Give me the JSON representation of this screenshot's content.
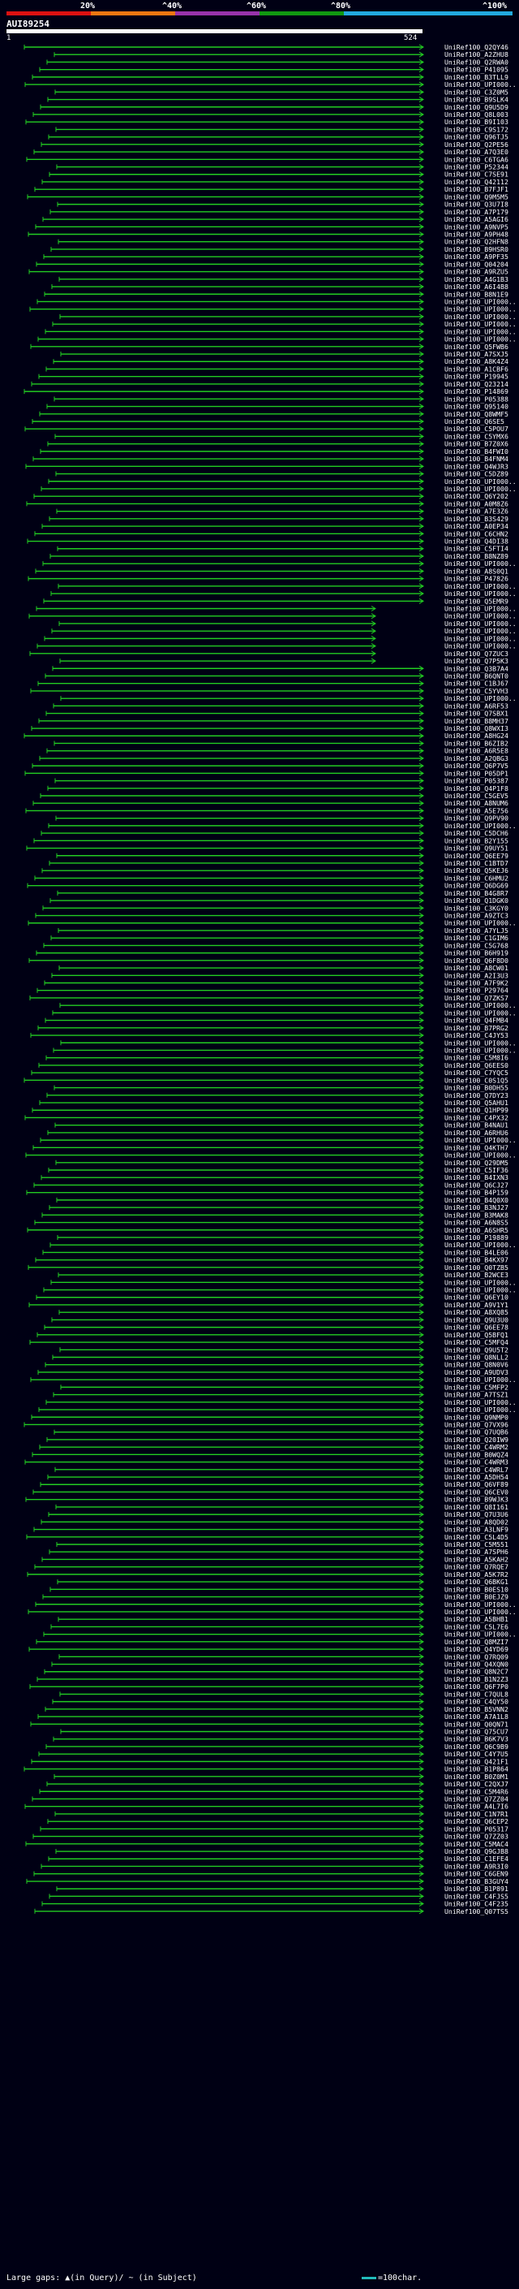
{
  "scale": {
    "colors": [
      "#dd1111",
      "#ee7711",
      "#9933aa",
      "#119911",
      "#22aadd"
    ],
    "labels": [
      "20%",
      "^40%",
      "^60%",
      "^80%",
      "^100%"
    ]
  },
  "query": {
    "title": "AUI89254",
    "start_label": "1",
    "end_label": "524"
  },
  "alignments": {
    "line_color": "#22cc22",
    "label_color": "#ffffff",
    "labels": [
      "UniRef100_Q2QY46",
      "UniRef100_A2ZHU8",
      "UniRef100_Q2RWA0",
      "UniRef100_P41095",
      "UniRef100_B3TLL9",
      "UniRef100_UPI000..",
      "UniRef100_C3Z0M5",
      "UniRef100_B9SLK4",
      "UniRef100_Q9U5D9",
      "UniRef100_Q8L003",
      "UniRef100_B9I103",
      "UniRef100_C9S172",
      "UniRef100_Q96TJ5",
      "UniRef100_Q2PE56",
      "UniRef100_A7Q3E0",
      "UniRef100_C6TGA6",
      "UniRef100_P52344",
      "UniRef100_C7SE91",
      "UniRef100_Q42112",
      "UniRef100_B7FJF1",
      "UniRef100_Q9M5M5",
      "UniRef100_Q3U7I8",
      "UniRef100_A7P179",
      "UniRef100_A5AGI6",
      "UniRef100_A9NVP5",
      "UniRef100_A9PH48",
      "UniRef100_Q2HFN8",
      "UniRef100_B9HSR0",
      "UniRef100_A9PF35",
      "UniRef100_Q04204",
      "UniRef100_A9RZU5",
      "UniRef100_A4G1B3",
      "UniRef100_A6I4B8",
      "UniRef100_B8N1E9",
      "UniRef100_UPI000..",
      "UniRef100_UPI000..",
      "UniRef100_UPI000..",
      "UniRef100_UPI000..",
      "UniRef100_UPI000..",
      "UniRef100_UPI000..",
      "UniRef100_Q5FWB6",
      "UniRef100_A7SXJ5",
      "UniRef100_A8K4Z4",
      "UniRef100_A1CBF6",
      "UniRef100_P19945",
      "UniRef100_Q23214",
      "UniRef100_P14869",
      "UniRef100_P05388",
      "UniRef100_Q95140",
      "UniRef100_Q8WMF5",
      "UniRef100_Q6SE5",
      "UniRef100_C5POU7",
      "UniRef100_C5YMX6",
      "UniRef100_B7Z0X6",
      "UniRef100_B4FWI0",
      "UniRef100_B4FNM4",
      "UniRef100_Q4WJR3",
      "UniRef100_C5DZ89",
      "UniRef100_UPI000..",
      "UniRef100_UPI000..",
      "UniRef100_Q6Y202",
      "UniRef100_A0M8Z6",
      "UniRef100_A7E3Z6",
      "UniRef100_B3S429",
      "UniRef100_A0EP34",
      "UniRef100_C6CHN2",
      "UniRef100_Q4DI38",
      "UniRef100_C5FTI4",
      "UniRef100_B8NZ89",
      "UniRef100_UPI000..",
      "UniRef100_A8S0Q1",
      "UniRef100_P47826",
      "UniRef100_UPI000..",
      "UniRef100_UPI000..",
      "UniRef100_Q5EMR9",
      "UniRef100_UPI000..",
      "UniRef100_UPI000..",
      "UniRef100_UPI000..",
      "UniRef100_UPI000..",
      "UniRef100_UPI000..",
      "UniRef100_UPI000..",
      "UniRef100_Q7ZUC3",
      "UniRef100_Q7P5K3",
      "UniRef100_Q3B7A4",
      "UniRef100_B6QNT0",
      "UniRef100_C1BJ67",
      "UniRef100_C5YVH3",
      "UniRef100_UPI000..",
      "UniRef100_A6RF53",
      "UniRef100_Q7SBX1",
      "UniRef100_B8MH37",
      "UniRef100_Q8WXI3",
      "UniRef100_A8HG24",
      "UniRef100_B6ZIB2",
      "UniRef100_A6R5E8",
      "UniRef100_A2QBG3",
      "UniRef100_Q6P7V5",
      "UniRef100_P05DP1",
      "UniRef100_P05387",
      "UniRef100_Q4P1F8",
      "UniRef100_C5GEV5",
      "UniRef100_A8NUM6",
      "UniRef100_A5E756",
      "UniRef100_Q9PV90",
      "UniRef100_UPI000..",
      "UniRef100_C5DCH6",
      "UniRef100_B2Y155",
      "UniRef100_Q9UY51",
      "UniRef100_Q6EE79",
      "UniRef100_C1BTD7",
      "UniRef100_Q5KEJ6",
      "UniRef100_C6HMU2",
      "UniRef100_Q6DG69",
      "UniRef100_B4G8R7",
      "UniRef100_Q1DGK0",
      "UniRef100_C3KGY0",
      "UniRef100_A9ZTC3",
      "UniRef100_UPI000..",
      "UniRef100_A7YLJ5",
      "UniRef100_C1GIM6",
      "UniRef100_C5G768",
      "UniRef100_B6H919",
      "UniRef100_Q6F8D0",
      "UniRef100_A8CW01",
      "UniRef100_A2I3U3",
      "UniRef100_A7F9K2",
      "UniRef100_P29764",
      "UniRef100_Q7ZKS7",
      "UniRef100_UPI000..",
      "UniRef100_UPI000..",
      "UniRef100_Q4FMB4",
      "UniRef100_B7PRG2",
      "UniRef100_C4JY53",
      "UniRef100_UPI000..",
      "UniRef100_UPI000..",
      "UniRef100_C5M8I6",
      "UniRef100_Q6EES0",
      "UniRef100_C7YQC5",
      "UniRef100_C0S1Q5",
      "UniRef100_B0DH55",
      "UniRef100_Q7DY23",
      "UniRef100_Q5AHU1",
      "UniRef100_Q1HP99",
      "UniRef100_C4PX32",
      "UniRef100_B4NAU1",
      "UniRef100_A6RHU6",
      "UniRef100_UPI000..",
      "UniRef100_Q4KTH7",
      "UniRef100_UPI000..",
      "UniRef100_Q29DM5",
      "UniRef100_C5IF36",
      "UniRef100_B4IXN3",
      "UniRef100_Q6CJ27",
      "UniRef100_B4P159",
      "UniRef100_B4Q0X0",
      "UniRef100_B3NJ27",
      "UniRef100_B3MAK8",
      "UniRef100_A6N8S5",
      "UniRef100_A6SHR5",
      "UniRef100_P19889",
      "UniRef100_UPI000..",
      "UniRef100_B4LE06",
      "UniRef100_B4KX97",
      "UniRef100_Q0TZB5",
      "UniRef100_B2WCE3",
      "UniRef100_UPI000..",
      "UniRef100_UPI000..",
      "UniRef100_Q6EY10",
      "UniRef100_A9V1Y1",
      "UniRef100_A8XQ85",
      "UniRef100_Q9U3U0",
      "UniRef100_Q6EE78",
      "UniRef100_Q5BFQ1",
      "UniRef100_C5MFQ4",
      "UniRef100_Q9U5T2",
      "UniRef100_Q8NLL2",
      "UniRef100_Q8N0V6",
      "UniRef100_A9UDV3",
      "UniRef100_UPI000..",
      "UniRef100_C5MFP2",
      "UniRef100_A7TSZ1",
      "UniRef100_UPI000..",
      "UniRef100_UPI000..",
      "UniRef100_Q9NMP0",
      "UniRef100_Q7VX96",
      "UniRef100_Q7UQB6",
      "UniRef100_Q20IW9",
      "UniRef100_C4WRM2",
      "UniRef100_B0WQZ4",
      "UniRef100_C4WRM3",
      "UniRef100_C4WRL7",
      "UniRef100_A5DH54",
      "UniRef100_Q6VF89",
      "UniRef100_Q6CEV0",
      "UniRef100_B9WJK3",
      "UniRef100_Q8I161",
      "UniRef100_Q7U3U6",
      "UniRef100_A8QD02",
      "UniRef100_A3LNF9",
      "UniRef100_C5L4D5",
      "UniRef100_C5M551",
      "UniRef100_A7SPH6",
      "UniRef100_A5KAH2",
      "UniRef100_Q7RQE7",
      "UniRef100_A5K7R2",
      "UniRef100_Q6BKG1",
      "UniRef100_B0ES10",
      "UniRef100_B0EJZ9",
      "UniRef100_UPI000..",
      "UniRef100_UPI000..",
      "UniRef100_A5BHB1",
      "UniRef100_C5L7E6",
      "UniRef100_UPI000..",
      "UniRef100_Q8MZI7",
      "UniRef100_Q4YD69",
      "UniRef100_Q7RQ09",
      "UniRef100_Q4XQN0",
      "UniRef100_Q8N2C7",
      "UniRef100_B1N2Z3",
      "UniRef100_Q6F7P0",
      "UniRef100_C7QUL8",
      "UniRef100_C4QY50",
      "UniRef100_B5VNN2",
      "UniRef100_A7A1L8",
      "UniRef100_Q0QN71",
      "UniRef100_Q75CU7",
      "UniRef100_B6K7V3",
      "UniRef100_Q6C9B9",
      "UniRef100_C4Y7U5",
      "UniRef100_Q421F1",
      "UniRef100_B1P864",
      "UniRef100_B0Z0M1",
      "UniRef100_C2QXJ7",
      "UniRef100_C5M4R6",
      "UniRef100_Q7ZZ04",
      "UniRef100_A4L7I6",
      "UniRef100_C1N7R1",
      "UniRef100_Q6CEP2",
      "UniRef100_P05317",
      "UniRef100_Q7ZZ03",
      "UniRef100_C5MAC4",
      "UniRef100_Q9GJB8",
      "UniRef100_C1EFE4",
      "UniRef100_A9R3I0",
      "UniRef100_C6GEN9",
      "UniRef100_B3GUY4",
      "UniRef100_B1P891",
      "UniRef100_C4FJS5",
      "UniRef100_C4F235",
      "UniRef100_Q07TS5"
    ]
  },
  "footer": {
    "gaps_text": "Large gaps: ▲(in Query)/ ~ (in Subject)",
    "legend_text": "=100char."
  }
}
